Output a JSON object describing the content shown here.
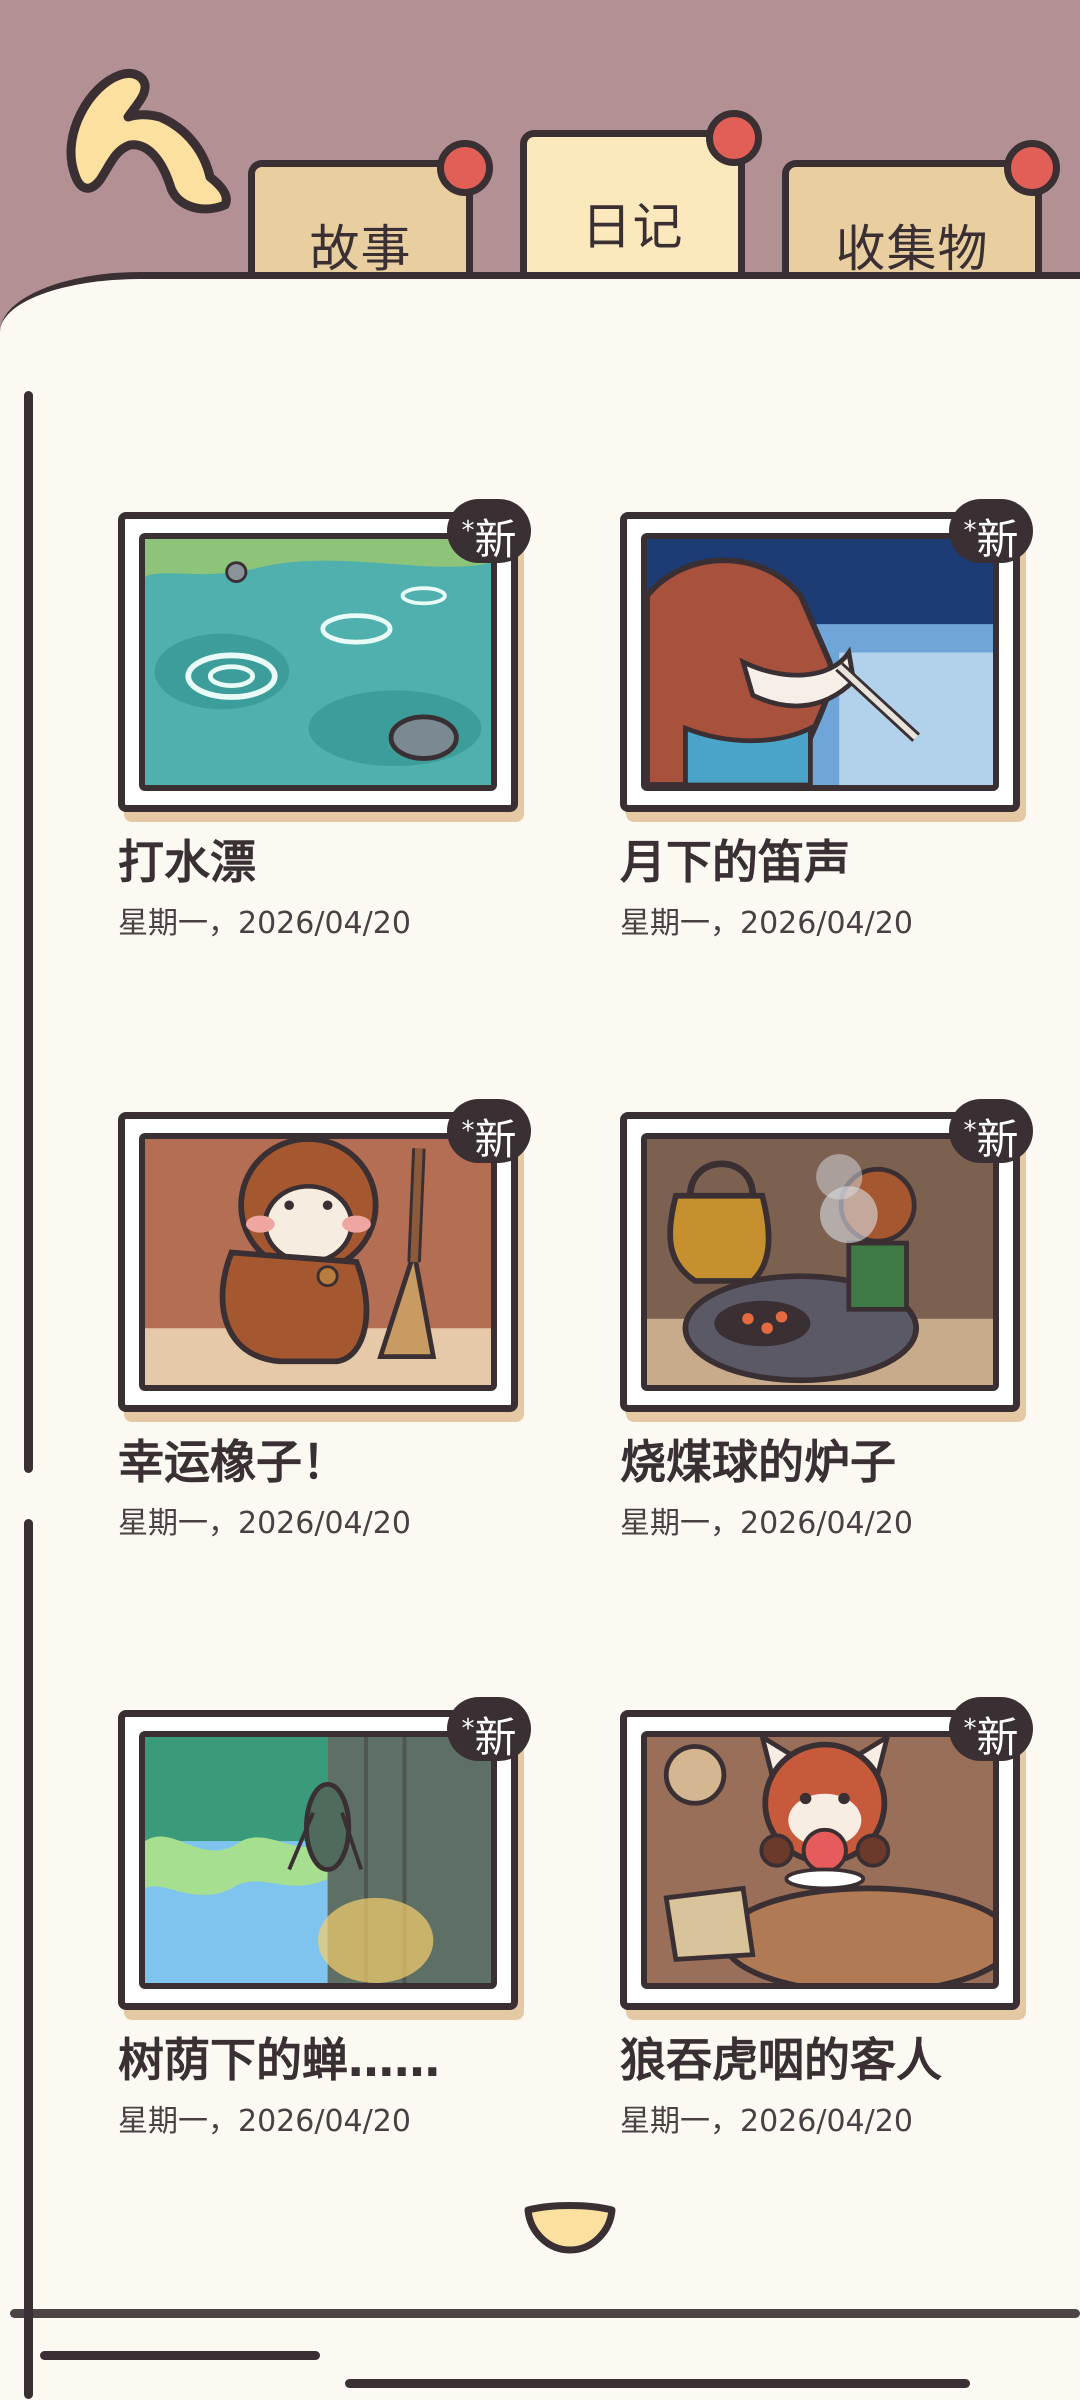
{
  "tabs": [
    {
      "label": "故事",
      "active": false
    },
    {
      "label": "日记",
      "active": true
    },
    {
      "label": "收集物",
      "active": false
    }
  ],
  "badge_label": "*新",
  "badge_text": "新",
  "entries": [
    {
      "title": "打水漂",
      "date": "星期一，2026/04/20",
      "is_new": true,
      "scene": "pond-stone-skipping"
    },
    {
      "title": "月下的笛声",
      "date": "星期一，2026/04/20",
      "is_new": true,
      "scene": "fox-playing-flute"
    },
    {
      "title": "幸运橡子！",
      "date": "星期一，2026/04/20",
      "is_new": true,
      "scene": "squirrel-with-broom"
    },
    {
      "title": "烧煤球的炉子",
      "date": "星期一，2026/04/20",
      "is_new": true,
      "scene": "coal-stove-kettle"
    },
    {
      "title": "树荫下的蝉……",
      "date": "星期一，2026/04/20",
      "is_new": true,
      "scene": "cicada-on-tree"
    },
    {
      "title": "狼吞虎咽的客人",
      "date": "星期一，2026/04/20",
      "is_new": true,
      "scene": "red-panda-eating"
    }
  ],
  "colors": {
    "header_bg": "#b39094",
    "page_bg": "#fcf9f3",
    "outline": "#3a2f33",
    "tab": "#e9cf9f",
    "pin": "#e25f58",
    "accent_yellow": "#fbe0a0"
  }
}
